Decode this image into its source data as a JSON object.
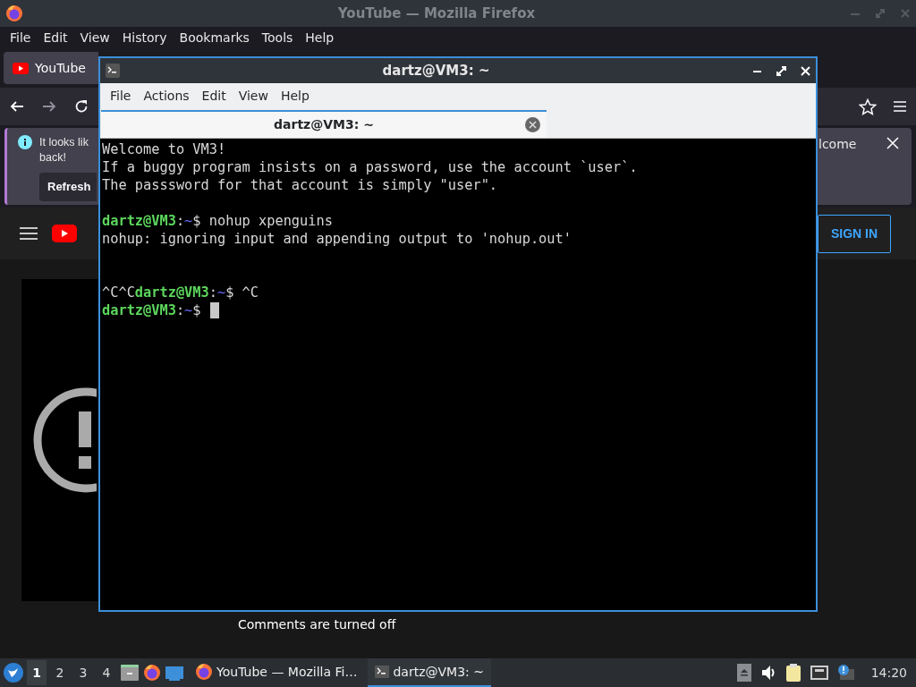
{
  "firefox": {
    "title": "YouTube — Mozilla Firefox",
    "menu": [
      "File",
      "Edit",
      "View",
      "History",
      "Bookmarks",
      "Tools",
      "Help"
    ],
    "tabs": [
      {
        "label": "YouTube",
        "selected": true
      }
    ],
    "notification": {
      "message_lines": [
        "It looks lik",
        "back!"
      ],
      "message_end": "lcome",
      "button": "Refresh"
    },
    "youtube": {
      "sign_in": "SIGN IN",
      "comments": "Comments are turned off"
    }
  },
  "terminal": {
    "title": "dartz@VM3: ~",
    "menu": [
      "File",
      "Actions",
      "Edit",
      "View",
      "Help"
    ],
    "tabs": [
      {
        "label": "dartz@VM3: ~",
        "selected": true
      }
    ],
    "lines": [
      {
        "kind": "text",
        "segments": [
          {
            "kind": "plain",
            "text": "Welcome to VM3!"
          }
        ]
      },
      {
        "kind": "text",
        "segments": [
          {
            "kind": "plain",
            "text": "If a buggy program insists on a password, use the account `user`."
          }
        ]
      },
      {
        "kind": "text",
        "segments": [
          {
            "kind": "plain",
            "text": "The passsword for that account is simply \"user\"."
          }
        ]
      },
      {
        "kind": "blank"
      },
      {
        "kind": "text",
        "segments": [
          {
            "kind": "user",
            "text": "dartz@VM3"
          },
          {
            "kind": "sep",
            "text": ":"
          },
          {
            "kind": "path",
            "text": "~"
          },
          {
            "kind": "plain",
            "text": "$ nohup xpenguins"
          }
        ]
      },
      {
        "kind": "text",
        "segments": [
          {
            "kind": "plain",
            "text": "nohup: ignoring input and appending output to 'nohup.out'"
          }
        ]
      },
      {
        "kind": "blank"
      },
      {
        "kind": "blank"
      },
      {
        "kind": "text",
        "segments": [
          {
            "kind": "plain",
            "text": "^C^C"
          },
          {
            "kind": "user",
            "text": "dartz@VM3"
          },
          {
            "kind": "sep",
            "text": ":"
          },
          {
            "kind": "path",
            "text": "~"
          },
          {
            "kind": "plain",
            "text": "$ ^C"
          }
        ]
      },
      {
        "kind": "text",
        "cursor": true,
        "segments": [
          {
            "kind": "user",
            "text": "dartz@VM3"
          },
          {
            "kind": "sep",
            "text": ":"
          },
          {
            "kind": "path",
            "text": "~"
          },
          {
            "kind": "plain",
            "text": "$"
          }
        ]
      }
    ]
  },
  "taskbar": {
    "workspaces": [
      {
        "label": "1",
        "selected": true
      },
      {
        "label": "2",
        "selected": false
      },
      {
        "label": "3",
        "selected": false
      },
      {
        "label": "4",
        "selected": false
      }
    ],
    "tasks": [
      {
        "kind": "firefox",
        "label": "YouTube — Mozilla Fi…",
        "selected": false
      },
      {
        "kind": "terminal",
        "label": "dartz@VM3: ~",
        "selected": true
      }
    ],
    "clock": "14:20"
  }
}
